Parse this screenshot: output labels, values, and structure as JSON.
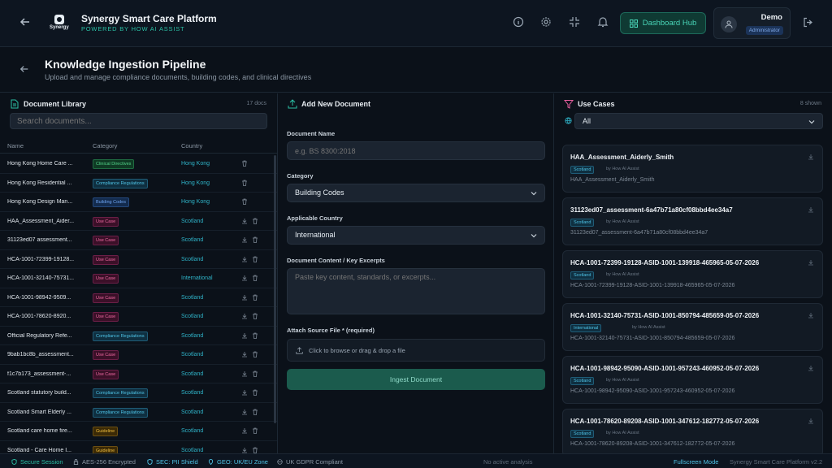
{
  "app": {
    "title": "Synergy Smart Care Platform",
    "subtitle": "POWERED BY HOW AI ASSIST",
    "logo_text": "Synergy",
    "dashboard_button": "Dashboard Hub",
    "user_name": "Demo",
    "user_role": "Administrator",
    "icons": [
      "back-arrow-icon",
      "info-icon",
      "gear-icon",
      "collapse-icon",
      "bell-icon",
      "grid-icon",
      "user-icon",
      "logout-icon"
    ]
  },
  "page": {
    "title": "Knowledge Ingestion Pipeline",
    "subtitle": "Upload and manage compliance documents, building codes, and clinical directives"
  },
  "library": {
    "title": "Document Library",
    "count": "17 docs",
    "search_placeholder": "Search documents...",
    "columns": [
      "Name",
      "Category",
      "Country"
    ],
    "rows": [
      {
        "name": "Hong Kong Home Care ...",
        "category": "Clinical Directives",
        "cat_class": "b-clin",
        "country": "Hong Kong",
        "download": false
      },
      {
        "name": "Hong Kong Residential ...",
        "category": "Compliance Regulations",
        "cat_class": "b-comp",
        "country": "Hong Kong",
        "download": false
      },
      {
        "name": "Hong Kong Design Man...",
        "category": "Building Codes",
        "cat_class": "b-build",
        "country": "Hong Kong",
        "download": false
      },
      {
        "name": "HAA_Assessment_Aider...",
        "category": "Use Case",
        "cat_class": "b-use",
        "country": "Scotland",
        "download": true
      },
      {
        "name": "31123ed07 assessment...",
        "category": "Use Case",
        "cat_class": "b-use",
        "country": "Scotland",
        "download": true
      },
      {
        "name": "HCA-1001-72399-19128...",
        "category": "Use Case",
        "cat_class": "b-use",
        "country": "Scotland",
        "download": true
      },
      {
        "name": "HCA-1001-32140-75731...",
        "category": "Use Case",
        "cat_class": "b-use",
        "country": "International",
        "download": true
      },
      {
        "name": "HCA-1001-98942-9509...",
        "category": "Use Case",
        "cat_class": "b-use",
        "country": "Scotland",
        "download": true
      },
      {
        "name": "HCA-1001-78620-8920...",
        "category": "Use Case",
        "cat_class": "b-use",
        "country": "Scotland",
        "download": true
      },
      {
        "name": "Official Regulatory Refe...",
        "category": "Compliance Regulations",
        "cat_class": "b-comp",
        "country": "Scotland",
        "download": true
      },
      {
        "name": "9bab1bc8b_assessment...",
        "category": "Use Case",
        "cat_class": "b-use",
        "country": "Scotland",
        "download": true
      },
      {
        "name": "f1c7b173_assessment-...",
        "category": "Use Case",
        "cat_class": "b-use",
        "country": "Scotland",
        "download": true
      },
      {
        "name": "Scotland statutory build...",
        "category": "Compliance Regulations",
        "cat_class": "b-comp",
        "country": "Scotland",
        "download": true
      },
      {
        "name": "Scotland Smart Elderly ...",
        "category": "Compliance Regulations",
        "cat_class": "b-comp",
        "country": "Scotland",
        "download": true
      },
      {
        "name": "Scotland care home fire...",
        "category": "Guideline",
        "cat_class": "b-guide",
        "country": "Scotland",
        "download": true
      },
      {
        "name": "Scotland - Care Home I...",
        "category": "Guideline",
        "cat_class": "b-guide",
        "country": "Scotland",
        "download": true
      }
    ]
  },
  "form": {
    "title": "Add New Document",
    "name_label": "Document Name",
    "name_placeholder": "e.g. BS 8300:2018",
    "category_label": "Category",
    "category_value": "Building Codes",
    "country_label": "Applicable Country",
    "country_value": "International",
    "content_label": "Document Content / Key Excerpts",
    "content_placeholder": "Paste key content, standards, or excerpts...",
    "file_label": "Attach Source File * (required)",
    "file_prompt": "Click to browse or drag & drop a file",
    "submit": "Ingest Document"
  },
  "usecases": {
    "title": "Use Cases",
    "count": "8 shown",
    "filter_value": "All",
    "by_text": "by How AI Assist",
    "cards": [
      {
        "title": "HAA_Assessment_Aiderly_Smith",
        "badge": "Scotland",
        "subtitle": "HAA_Assessment_Aiderly_Smith"
      },
      {
        "title": "31123ed07_assessment-6a47b71a80cf08bbd4ee34a7",
        "badge": "Scotland",
        "subtitle": "31123ed07_assessment-6a47b71a80cf08bbd4ee34a7"
      },
      {
        "title": "HCA-1001-72399-19128-ASID-1001-139918-465965-05-07-2026",
        "badge": "Scotland",
        "subtitle": "HCA-1001-72399-19128-ASID-1001-139918-465965-05-07-2026"
      },
      {
        "title": "HCA-1001-32140-75731-ASID-1001-850794-485659-05-07-2026",
        "badge": "International",
        "subtitle": "HCA-1001-32140-75731-ASID-1001-850794-485659-05-07-2026"
      },
      {
        "title": "HCA-1001-98942-95090-ASID-1001-957243-460952-05-07-2026",
        "badge": "Scotland",
        "subtitle": "HCA-1001-98942-95090-ASID-1001-957243-460952-05-07-2026"
      },
      {
        "title": "HCA-1001-78620-89208-ASID-1001-347612-182772-05-07-2026",
        "badge": "Scotland",
        "subtitle": "HCA-1001-78620-89208-ASID-1001-347612-182772-05-07-2026"
      }
    ]
  },
  "footer": {
    "secure": "Secure Session",
    "aes": "AES-256 Encrypted",
    "pii": "SEC: PII Shield",
    "geo": "GEO: UK/EU Zone",
    "gdpr": "UK GDPR Compliant",
    "analysis": "No active analysis",
    "fullscreen": "Fullscreen Mode",
    "version": "Synergy Smart Care Platform v2.2"
  },
  "colors": {
    "accent": "#2bbfa4",
    "background": "#0b1119",
    "panel": "#121a24",
    "link": "#2fb4c9"
  }
}
